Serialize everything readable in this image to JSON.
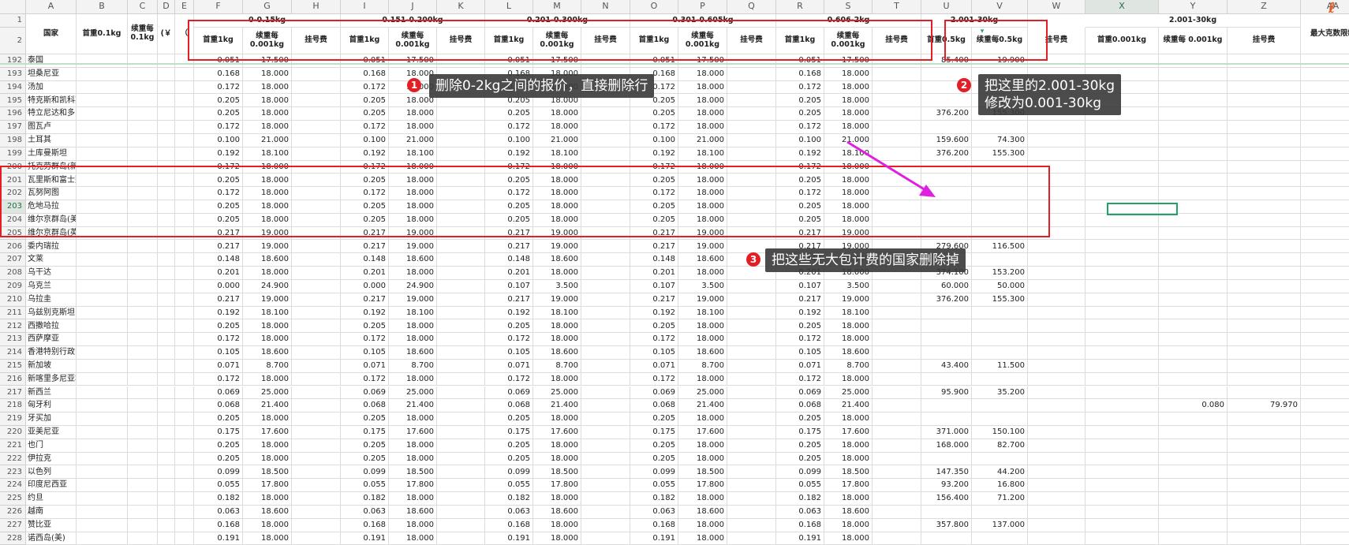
{
  "columns": [
    "A",
    "B",
    "C",
    "D",
    "E",
    "F",
    "G",
    "H",
    "I",
    "J",
    "K",
    "L",
    "M",
    "N",
    "O",
    "P",
    "Q",
    "R",
    "S",
    "T",
    "U",
    "V",
    "W",
    "X",
    "Y",
    "Z",
    "AA"
  ],
  "header_row1": [
    {
      "col": 6,
      "span": 3,
      "text": "0-0.15kg"
    },
    {
      "col": 9,
      "span": 3,
      "text": "0.151-0.200kg"
    },
    {
      "col": 12,
      "span": 3,
      "text": "0.201-0.300kg"
    },
    {
      "col": 15,
      "span": 3,
      "text": "0.301-0.605kg"
    },
    {
      "col": 18,
      "span": 3,
      "text": "0.606-2kg"
    },
    {
      "col": 21,
      "span": 2,
      "text": "2.001-30kg"
    },
    {
      "col": 24,
      "span": 3,
      "text": "2.001-30kg"
    }
  ],
  "header_tall": [
    {
      "col": 1,
      "text": "国家"
    },
    {
      "col": 2,
      "text": "首重0.1kg"
    },
    {
      "col": 3,
      "text": "续重每0.1kg"
    },
    {
      "col": 4,
      "text": "(￥"
    },
    {
      "col": 5,
      "text": "（"
    },
    {
      "col": 27,
      "text": "最大克数限制"
    }
  ],
  "header_row2": [
    {
      "col": 6,
      "text": "首重1kg"
    },
    {
      "col": 7,
      "text": "续重每 0.001kg"
    },
    {
      "col": 8,
      "text": "挂号费"
    },
    {
      "col": 9,
      "text": "首重1kg"
    },
    {
      "col": 10,
      "text": "续重每 0.001kg"
    },
    {
      "col": 11,
      "text": "挂号费"
    },
    {
      "col": 12,
      "text": "首重1kg"
    },
    {
      "col": 13,
      "text": "续重每 0.001kg"
    },
    {
      "col": 14,
      "text": "挂号费"
    },
    {
      "col": 15,
      "text": "首重1kg"
    },
    {
      "col": 16,
      "text": "续重每 0.001kg"
    },
    {
      "col": 17,
      "text": "挂号费"
    },
    {
      "col": 18,
      "text": "首重1kg"
    },
    {
      "col": 19,
      "text": "续重每 0.001kg"
    },
    {
      "col": 20,
      "text": "挂号费"
    },
    {
      "col": 21,
      "text": "首重0.5kg"
    },
    {
      "col": 22,
      "text": "续重每0.5kg"
    },
    {
      "col": 23,
      "text": "挂号费"
    },
    {
      "col": 24,
      "text": "首重0.001kg"
    },
    {
      "col": 25,
      "text": "续重每 0.001kg"
    },
    {
      "col": 26,
      "text": "挂号费"
    }
  ],
  "rows": [
    {
      "n": "192",
      "name": "泰国",
      "g": "0.051",
      "h": "17.500",
      "j": "0.051",
      "k": "17.500",
      "m": "0.051",
      "nn": "17.500",
      "p": "0.051",
      "q": "17.500",
      "s": "0.051",
      "t": "17.500",
      "u": "85.400",
      "v": "19.900"
    },
    {
      "n": "193",
      "name": "坦桑尼亚",
      "g": "0.168",
      "h": "18.000",
      "j": "0.168",
      "k": "18.000",
      "m": "0.168",
      "nn": "18.000",
      "p": "0.168",
      "q": "18.000",
      "s": "0.168",
      "t": "18.000"
    },
    {
      "n": "194",
      "name": "汤加",
      "g": "0.172",
      "h": "18.000",
      "j": "0.172",
      "k": "18.000",
      "m": "0.172",
      "nn": "18.000",
      "p": "0.172",
      "q": "18.000",
      "s": "0.172",
      "t": "18.000"
    },
    {
      "n": "195",
      "name": "特克斯和凯科斯群岛(英)",
      "g": "0.205",
      "h": "18.000",
      "j": "0.205",
      "k": "18.000",
      "m": "0.205",
      "nn": "18.000",
      "p": "0.205",
      "q": "18.000",
      "s": "0.205",
      "t": "18.000"
    },
    {
      "n": "196",
      "name": "特立尼达和多巴哥",
      "g": "0.205",
      "h": "18.000",
      "j": "0.205",
      "k": "18.000",
      "m": "0.205",
      "nn": "18.000",
      "p": "0.205",
      "q": "18.000",
      "s": "0.205",
      "t": "18.000",
      "u": "376.200",
      "v": "155.300"
    },
    {
      "n": "197",
      "name": "图瓦卢",
      "g": "0.172",
      "h": "18.000",
      "j": "0.172",
      "k": "18.000",
      "m": "0.172",
      "nn": "18.000",
      "p": "0.172",
      "q": "18.000",
      "s": "0.172",
      "t": "18.000"
    },
    {
      "n": "198",
      "name": "土耳其",
      "g": "0.100",
      "h": "21.000",
      "j": "0.100",
      "k": "21.000",
      "m": "0.100",
      "nn": "21.000",
      "p": "0.100",
      "q": "21.000",
      "s": "0.100",
      "t": "21.000",
      "u": "159.600",
      "v": "74.300"
    },
    {
      "n": "199",
      "name": "土库曼斯坦",
      "g": "0.192",
      "h": "18.100",
      "j": "0.192",
      "k": "18.100",
      "m": "0.192",
      "nn": "18.100",
      "p": "0.192",
      "q": "18.100",
      "s": "0.192",
      "t": "18.100",
      "u": "376.200",
      "v": "155.300"
    },
    {
      "n": "200",
      "name": "托克劳群岛(新)",
      "g": "0.172",
      "h": "18.000",
      "j": "0.172",
      "k": "18.000",
      "m": "0.172",
      "nn": "18.000",
      "p": "0.172",
      "q": "18.000",
      "s": "0.172",
      "t": "18.000"
    },
    {
      "n": "201",
      "name": "瓦里斯和富士那群岛(法)",
      "g": "0.205",
      "h": "18.000",
      "j": "0.205",
      "k": "18.000",
      "m": "0.205",
      "nn": "18.000",
      "p": "0.205",
      "q": "18.000",
      "s": "0.205",
      "t": "18.000"
    },
    {
      "n": "202",
      "name": "瓦努阿图",
      "g": "0.172",
      "h": "18.000",
      "j": "0.172",
      "k": "18.000",
      "m": "0.172",
      "nn": "18.000",
      "p": "0.172",
      "q": "18.000",
      "s": "0.172",
      "t": "18.000"
    },
    {
      "n": "203",
      "name": "危地马拉",
      "g": "0.205",
      "h": "18.000",
      "j": "0.205",
      "k": "18.000",
      "m": "0.205",
      "nn": "18.000",
      "p": "0.205",
      "q": "18.000",
      "s": "0.205",
      "t": "18.000"
    },
    {
      "n": "204",
      "name": "维尔京群岛(美)",
      "g": "0.205",
      "h": "18.000",
      "j": "0.205",
      "k": "18.000",
      "m": "0.205",
      "nn": "18.000",
      "p": "0.205",
      "q": "18.000",
      "s": "0.205",
      "t": "18.000"
    },
    {
      "n": "205",
      "name": "维尔京群岛(英)",
      "g": "0.217",
      "h": "19.000",
      "j": "0.217",
      "k": "19.000",
      "m": "0.217",
      "nn": "19.000",
      "p": "0.217",
      "q": "19.000",
      "s": "0.217",
      "t": "19.000"
    },
    {
      "n": "206",
      "name": "委内瑞拉",
      "g": "0.217",
      "h": "19.000",
      "j": "0.217",
      "k": "19.000",
      "m": "0.217",
      "nn": "19.000",
      "p": "0.217",
      "q": "19.000",
      "s": "0.217",
      "t": "19.000",
      "u": "279.600",
      "v": "116.500"
    },
    {
      "n": "207",
      "name": "文莱",
      "g": "0.148",
      "h": "18.600",
      "j": "0.148",
      "k": "18.600",
      "m": "0.148",
      "nn": "18.600",
      "p": "0.148",
      "q": "18.600",
      "s": "0.148",
      "t": "18.600"
    },
    {
      "n": "208",
      "name": "乌干达",
      "g": "0.201",
      "h": "18.000",
      "j": "0.201",
      "k": "18.000",
      "m": "0.201",
      "nn": "18.000",
      "p": "0.201",
      "q": "18.000",
      "s": "0.201",
      "t": "18.000",
      "u": "374.100",
      "v": "153.200"
    },
    {
      "n": "209",
      "name": "乌克兰",
      "g": "0.000",
      "h": "24.900",
      "j": "0.000",
      "k": "24.900",
      "m": "0.107",
      "nn": "3.500",
      "p": "0.107",
      "q": "3.500",
      "s": "0.107",
      "t": "3.500",
      "u": "60.000",
      "v": "50.000"
    },
    {
      "n": "210",
      "name": "乌拉圭",
      "g": "0.217",
      "h": "19.000",
      "j": "0.217",
      "k": "19.000",
      "m": "0.217",
      "nn": "19.000",
      "p": "0.217",
      "q": "19.000",
      "s": "0.217",
      "t": "19.000",
      "u": "376.200",
      "v": "155.300"
    },
    {
      "n": "211",
      "name": "乌兹别克斯坦",
      "g": "0.192",
      "h": "18.100",
      "j": "0.192",
      "k": "18.100",
      "m": "0.192",
      "nn": "18.100",
      "p": "0.192",
      "q": "18.100",
      "s": "0.192",
      "t": "18.100"
    },
    {
      "n": "212",
      "name": "西撒哈拉",
      "g": "0.205",
      "h": "18.000",
      "j": "0.205",
      "k": "18.000",
      "m": "0.205",
      "nn": "18.000",
      "p": "0.205",
      "q": "18.000",
      "s": "0.205",
      "t": "18.000"
    },
    {
      "n": "213",
      "name": "西萨摩亚",
      "g": "0.172",
      "h": "18.000",
      "j": "0.172",
      "k": "18.000",
      "m": "0.172",
      "nn": "18.000",
      "p": "0.172",
      "q": "18.000",
      "s": "0.172",
      "t": "18.000"
    },
    {
      "n": "214",
      "name": "香港特别行政区",
      "g": "0.105",
      "h": "18.600",
      "j": "0.105",
      "k": "18.600",
      "m": "0.105",
      "nn": "18.600",
      "p": "0.105",
      "q": "18.600",
      "s": "0.105",
      "t": "18.600"
    },
    {
      "n": "215",
      "name": "新加坡",
      "g": "0.071",
      "h": "8.700",
      "j": "0.071",
      "k": "8.700",
      "m": "0.071",
      "nn": "8.700",
      "p": "0.071",
      "q": "8.700",
      "s": "0.071",
      "t": "8.700",
      "u": "43.400",
      "v": "11.500"
    },
    {
      "n": "216",
      "name": "新喀里多尼亚群岛(法",
      "g": "0.172",
      "h": "18.000",
      "j": "0.172",
      "k": "18.000",
      "m": "0.172",
      "nn": "18.000",
      "p": "0.172",
      "q": "18.000",
      "s": "0.172",
      "t": "18.000"
    },
    {
      "n": "217",
      "name": "新西兰",
      "g": "0.069",
      "h": "25.000",
      "j": "0.069",
      "k": "25.000",
      "m": "0.069",
      "nn": "25.000",
      "p": "0.069",
      "q": "25.000",
      "s": "0.069",
      "t": "25.000",
      "u": "95.900",
      "v": "35.200"
    },
    {
      "n": "218",
      "name": "匈牙利",
      "g": "0.068",
      "h": "21.400",
      "j": "0.068",
      "k": "21.400",
      "m": "0.068",
      "nn": "21.400",
      "p": "0.068",
      "q": "21.400",
      "s": "0.068",
      "t": "21.400",
      "y": "0.080",
      "z": "79.970"
    },
    {
      "n": "219",
      "name": "牙买加",
      "g": "0.205",
      "h": "18.000",
      "j": "0.205",
      "k": "18.000",
      "m": "0.205",
      "nn": "18.000",
      "p": "0.205",
      "q": "18.000",
      "s": "0.205",
      "t": "18.000"
    },
    {
      "n": "220",
      "name": "亚美尼亚",
      "g": "0.175",
      "h": "17.600",
      "j": "0.175",
      "k": "17.600",
      "m": "0.175",
      "nn": "17.600",
      "p": "0.175",
      "q": "17.600",
      "s": "0.175",
      "t": "17.600",
      "u": "371.000",
      "v": "150.100"
    },
    {
      "n": "221",
      "name": "也门",
      "g": "0.205",
      "h": "18.000",
      "j": "0.205",
      "k": "18.000",
      "m": "0.205",
      "nn": "18.000",
      "p": "0.205",
      "q": "18.000",
      "s": "0.205",
      "t": "18.000",
      "u": "168.000",
      "v": "82.700"
    },
    {
      "n": "222",
      "name": "伊拉克",
      "g": "0.205",
      "h": "18.000",
      "j": "0.205",
      "k": "18.000",
      "m": "0.205",
      "nn": "18.000",
      "p": "0.205",
      "q": "18.000",
      "s": "0.205",
      "t": "18.000"
    },
    {
      "n": "223",
      "name": "以色列",
      "g": "0.099",
      "h": "18.500",
      "j": "0.099",
      "k": "18.500",
      "m": "0.099",
      "nn": "18.500",
      "p": "0.099",
      "q": "18.500",
      "s": "0.099",
      "t": "18.500",
      "u": "147.350",
      "v": "44.200"
    },
    {
      "n": "224",
      "name": "印度尼西亚",
      "g": "0.055",
      "h": "17.800",
      "j": "0.055",
      "k": "17.800",
      "m": "0.055",
      "nn": "17.800",
      "p": "0.055",
      "q": "17.800",
      "s": "0.055",
      "t": "17.800",
      "u": "93.200",
      "v": "16.800"
    },
    {
      "n": "225",
      "name": "约旦",
      "g": "0.182",
      "h": "18.000",
      "j": "0.182",
      "k": "18.000",
      "m": "0.182",
      "nn": "18.000",
      "p": "0.182",
      "q": "18.000",
      "s": "0.182",
      "t": "18.000",
      "u": "156.400",
      "v": "71.200"
    },
    {
      "n": "226",
      "name": "越南",
      "g": "0.063",
      "h": "18.600",
      "j": "0.063",
      "k": "18.600",
      "m": "0.063",
      "nn": "18.600",
      "p": "0.063",
      "q": "18.600",
      "s": "0.063",
      "t": "18.600"
    },
    {
      "n": "227",
      "name": "赞比亚",
      "g": "0.168",
      "h": "18.000",
      "j": "0.168",
      "k": "18.000",
      "m": "0.168",
      "nn": "18.000",
      "p": "0.168",
      "q": "18.000",
      "s": "0.168",
      "t": "18.000",
      "u": "357.800",
      "v": "137.000"
    },
    {
      "n": "228",
      "name": "诺西岛(美)",
      "g": "0.191",
      "h": "18.000",
      "j": "0.191",
      "k": "18.000",
      "m": "0.191",
      "nn": "18.000",
      "p": "0.191",
      "q": "18.000",
      "s": "0.191",
      "t": "18.000"
    }
  ],
  "annotations": [
    {
      "badge": "1",
      "text": "删除0-2kg之间的报价，直接删除行"
    },
    {
      "badge": "2",
      "text": "把这里的2.001-30kg\n修改为0.001-30kg"
    },
    {
      "badge": "3",
      "text": "把这些无大包计费的国家删除掉"
    }
  ],
  "colors": {
    "highlight_box": "#e31f26",
    "arrow": "#e020e0",
    "selection": "#21a366"
  },
  "icons": {
    "filter": "filter-dropdown-icon",
    "corner": "app-logo-icon"
  }
}
